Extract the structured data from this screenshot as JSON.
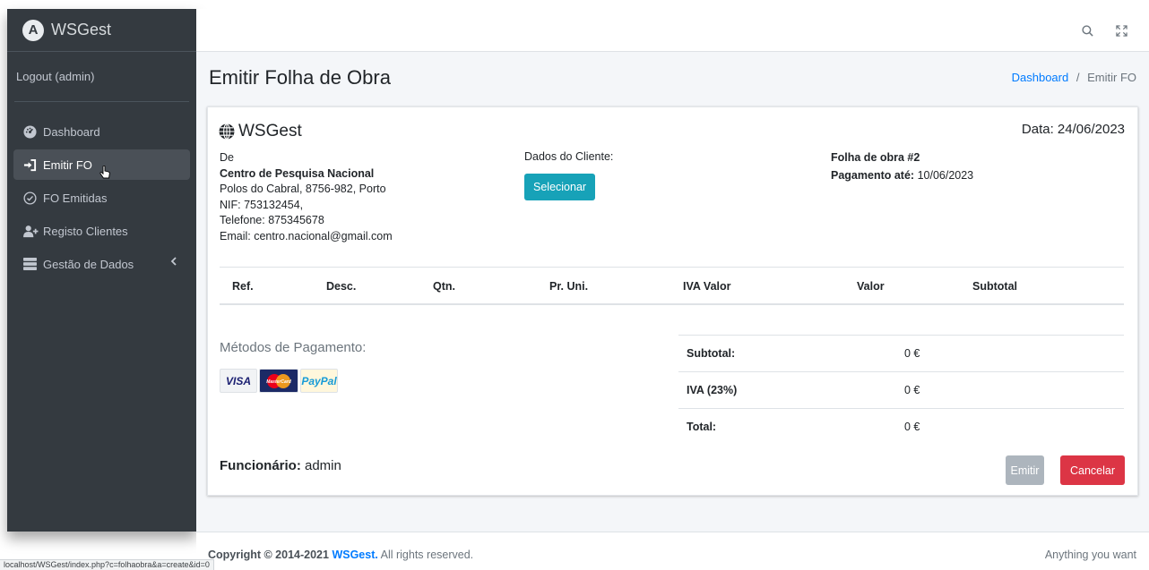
{
  "sidebar": {
    "brand": "WSGest",
    "logout": "Logout (admin)",
    "items": [
      {
        "label": "Dashboard"
      },
      {
        "label": "Emitir FO"
      },
      {
        "label": "FO Emitidas"
      },
      {
        "label": "Registo Clientes"
      },
      {
        "label": "Gestão de Dados"
      }
    ]
  },
  "page": {
    "title": "Emitir Folha de Obra",
    "breadcrumb_home": "Dashboard",
    "breadcrumb_sep": "/",
    "breadcrumb_current": "Emitir FO"
  },
  "invoice": {
    "brand": "WSGest",
    "date": "Data: 24/06/2023",
    "from_label": "De",
    "company": "Centro de Pesquisa Nacional",
    "address": "Polos do Cabral, 8756-982, Porto",
    "nif": "NIF: 753132454,",
    "phone": "Telefone: 875345678",
    "email": "Email: centro.nacional@gmail.com",
    "client_label": "Dados do Cliente:",
    "select_button": "Selecionar",
    "fo_number": "Folha de obra #2",
    "payment_label": "Pagamento até:",
    "payment_date": " 10/06/2023"
  },
  "table": {
    "headers": [
      "Ref.",
      "Desc.",
      "Qtn.",
      "Pr. Uni.",
      "IVA Valor",
      "Valor",
      "Subtotal"
    ]
  },
  "payment": {
    "title": "Métodos de Pagamento:",
    "cards": [
      "VISA",
      "MasterCard",
      "PayPal"
    ]
  },
  "totals": [
    {
      "label": "Subtotal:",
      "value": "0 €"
    },
    {
      "label": "IVA (23%)",
      "value": "0 €"
    },
    {
      "label": "Total:",
      "value": "0 €"
    }
  ],
  "employee": {
    "label": "Funcionário:",
    "name": " admin"
  },
  "actions": {
    "emit": "Emitir",
    "cancel": "Cancelar"
  },
  "footer": {
    "copyright": "Copyright © 2014-2021 ",
    "brand": "WSGest.",
    "rights": " All rights reserved.",
    "right_text": "Anything you want"
  },
  "status_url": "localhost/WSGest/index.php?c=folhaobra&a=create&id=0",
  "colors": {
    "sidebar_bg": "#343a40",
    "accent_info": "#17a2b8",
    "danger": "#dc3545",
    "link": "#007bff"
  }
}
